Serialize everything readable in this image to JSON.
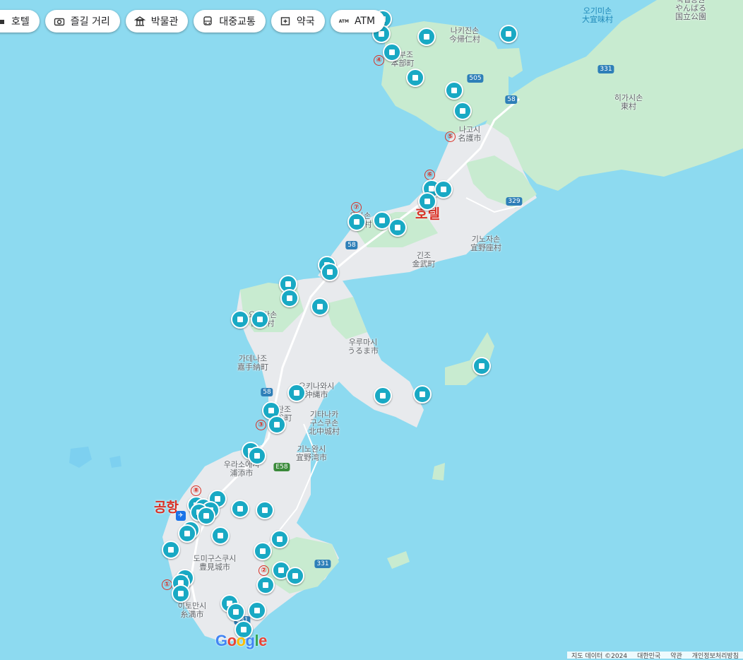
{
  "chips": [
    {
      "icon": "hotel-icon",
      "label": "호텔"
    },
    {
      "icon": "camera-icon",
      "label": "즐길 거리"
    },
    {
      "icon": "museum-icon",
      "label": "박물관"
    },
    {
      "icon": "bus-icon",
      "label": "대중교통"
    },
    {
      "icon": "pharmacy-icon",
      "label": "약국"
    },
    {
      "icon": "atm-icon",
      "label": "ATM",
      "icon_text": "ATM"
    }
  ],
  "place_labels": {
    "nakijin": "나키진손\n今帰仁村",
    "motobu": "모부조\n本部町",
    "nago": "나고시\n名護市",
    "onna": "온나손\n恩納村",
    "ginoza": "기노자손\n宜野座村",
    "kin": "긴조\n金武町",
    "yomitan": "요미탄손\n読谷村",
    "uruma": "우루마시\nうるま市",
    "kadena": "가데나조\n嘉手納町",
    "okinawa": "오키나와시\n沖縄市",
    "chatan": "자탄조\n北谷町",
    "kitanakagusuku": "기타나카\n구스쿠손\n北中城村",
    "ginowan": "기노완시\n宜野湾市",
    "urasoe": "우라소에시\n浦添市",
    "tomigusuku": "도미구스쿠시\n豊見城市",
    "itoman": "이토만시\n糸満市",
    "ogimi": "오기미손\n大宜味村",
    "higashi": "히가시손\n東村",
    "park": "국립공원\nやんばる\n国立公園"
  },
  "numbers": [
    "①",
    "②",
    "③",
    "④",
    "⑤",
    "⑥",
    "⑦",
    "⑧"
  ],
  "labels": {
    "hotel": "호텔",
    "airport": "공항"
  },
  "route_shields": [
    "505",
    "331",
    "58",
    "329",
    "58",
    "E58",
    "331",
    "58",
    "331"
  ],
  "google_logo": [
    "G",
    "o",
    "o",
    "g",
    "l",
    "e"
  ],
  "attribution": [
    "지도 데이터 ©2024",
    "대한민국",
    "약관",
    "개인정보처리방침"
  ],
  "colors": {
    "water": "#8ddaf0",
    "land": "#f1f3f4",
    "park": "#c8ebd0",
    "pin": "#19a9c4",
    "red": "#d93025"
  }
}
